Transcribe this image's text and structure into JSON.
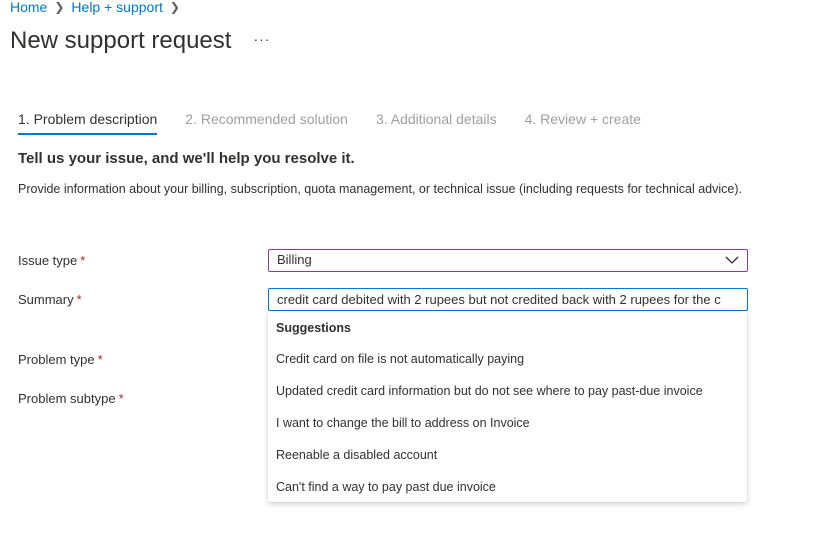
{
  "breadcrumb": {
    "items": [
      "Home",
      "Help + support"
    ]
  },
  "header": {
    "title": "New support request",
    "more_label": "···"
  },
  "tabs": [
    {
      "label": "1. Problem description",
      "active": true
    },
    {
      "label": "2. Recommended solution",
      "active": false
    },
    {
      "label": "3. Additional details",
      "active": false
    },
    {
      "label": "4. Review + create",
      "active": false
    }
  ],
  "main": {
    "heading": "Tell us your issue, and we'll help you resolve it.",
    "description": "Provide information about your billing, subscription, quota management, or technical issue (including requests for technical advice).",
    "required_marker": "*"
  },
  "form": {
    "issue_type": {
      "label": "Issue type",
      "value": "Billing"
    },
    "summary": {
      "label": "Summary",
      "value": "credit card debited with 2 rupees but not credited back with 2 rupees for the c"
    },
    "problem_type": {
      "label": "Problem type"
    },
    "problem_subtype": {
      "label": "Problem subtype"
    }
  },
  "suggestions": {
    "header": "Suggestions",
    "items": [
      "Credit card on file is not automatically paying",
      "Updated credit card information but do not see where to pay past-due invoice",
      "I want to change the bill to address on Invoice",
      "Reenable a disabled account",
      "Can't find a way to pay past due invoice"
    ]
  },
  "colors": {
    "accent": "#0078d4",
    "dropdown_border": "#8a3b93",
    "required": "#a4262c",
    "inactive_tab": "#a19f9d"
  },
  "icons": {
    "separator": "chevron-right-icon",
    "dropdown": "chevron-down-icon",
    "more": "more-icon"
  }
}
